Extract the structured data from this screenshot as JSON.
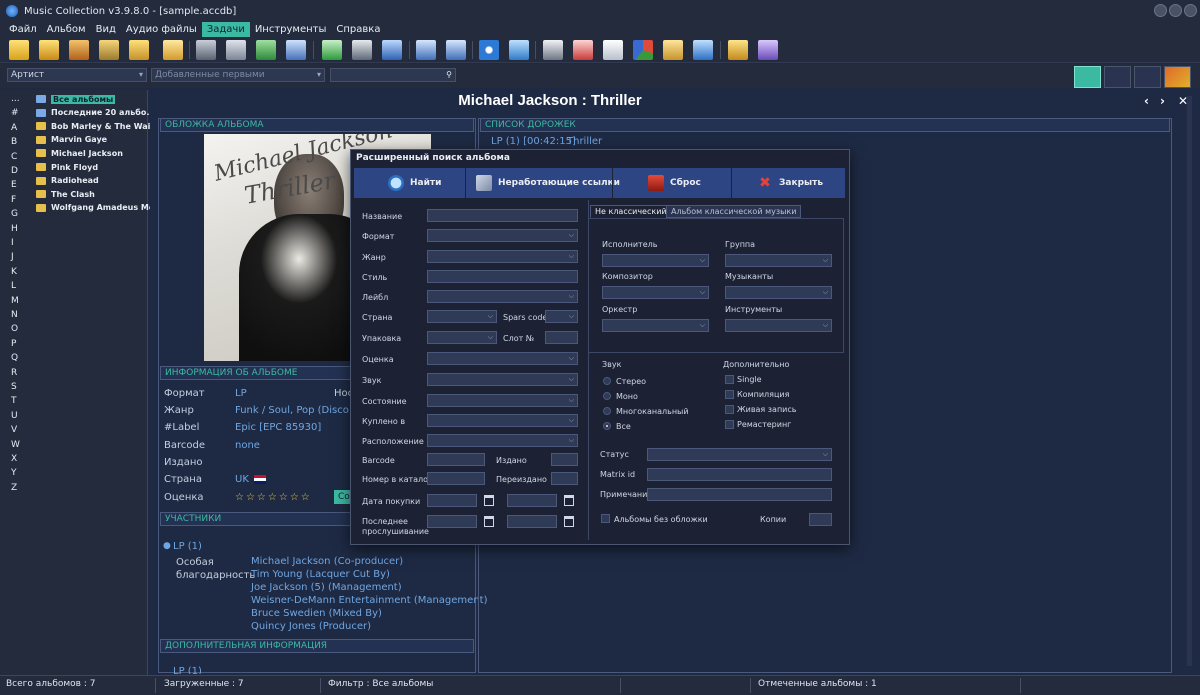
{
  "window": {
    "title": "Music Collection v3.9.8.0 - [sample.accdb]"
  },
  "menu": [
    "Файл",
    "Альбом",
    "Вид",
    "Аудио файлы",
    "Задачи",
    "Инструменты",
    "Справка"
  ],
  "filter": {
    "artist_combo": "Артист",
    "added_combo": "Добавленные первыми",
    "search_value": ""
  },
  "letters": [
    "...",
    "#",
    "A",
    "B",
    "C",
    "D",
    "E",
    "F",
    "G",
    "H",
    "I",
    "J",
    "K",
    "L",
    "M",
    "N",
    "O",
    "P",
    "Q",
    "R",
    "S",
    "T",
    "U",
    "V",
    "W",
    "X",
    "Y",
    "Z"
  ],
  "tree": [
    "Все альбомы",
    "Последние 20 альбо...",
    "Bob Marley & The Wai...",
    "Marvin Gaye",
    "Michael Jackson",
    "Pink Floyd",
    "Radiohead",
    "The Clash",
    "Wolfgang Amadeus Mo..."
  ],
  "album": {
    "title": "Michael Jackson : Thriller"
  },
  "sections": {
    "cover": "ОБЛОЖКА АЛЬБОМА",
    "tracks": "СПИСОК ДОРОЖЕК",
    "info": "ИНФОРМАЦИЯ ОБ АЛЬБОМЕ",
    "participants": "УЧАСТНИКИ",
    "extra": "ДОПОЛНИТЕЛЬНАЯ ИНФОРМАЦИЯ"
  },
  "tracklist": {
    "disc": "LP (1) [00:42:15]",
    "album": "Thriller"
  },
  "cover_art": {
    "line1": "Michael",
    "line2": "Jackson",
    "line3": "Thriller"
  },
  "info": [
    {
      "label": "Формат",
      "value": "LP"
    },
    {
      "label": "Жанр",
      "value": "Funk / Soul, Pop (Disco)"
    },
    {
      "label": "#Label",
      "value": "Epic [EPC 85930]"
    },
    {
      "label": "Barcode",
      "value": "none"
    },
    {
      "label": "Издано",
      "value": ""
    },
    {
      "label": "Страна",
      "value": "UK"
    },
    {
      "label": "Оценка",
      "value": "☆☆☆☆☆☆☆"
    }
  ],
  "info_extra": {
    "truncated_label": "Нос",
    "save_button": "Со"
  },
  "participants": {
    "disc": "LP (1)",
    "role": "Особая благодарность",
    "people": [
      "Michael Jackson (Co-producer)",
      "Tim Young (Lacquer Cut By)",
      "Joe Jackson (5) (Management)",
      "Weisner-DeMann Entertainment (Management)",
      "Bruce Swedien (Mixed By)",
      "Quincy Jones (Producer)"
    ],
    "extra_truncated": "LP (1)"
  },
  "dialog": {
    "title": "Расширенный поиск альбома",
    "buttons": {
      "find": "Найти",
      "broken": "Неработающие ссылки",
      "reset": "Сброс",
      "close": "Закрыть"
    },
    "fields": {
      "name": "Название",
      "format": "Формат",
      "genre": "Жанр",
      "style": "Стиль",
      "label": "Лейбл",
      "country": "Страна",
      "spars": "Spars code",
      "package": "Упаковка",
      "slot": "Слот №",
      "rating": "Оценка",
      "sound": "Звук",
      "condition": "Состояние",
      "bought": "Куплено в",
      "location": "Расположение",
      "barcode": "Barcode",
      "issued": "Издано",
      "catalog": "Номер в каталог",
      "reissued": "Переиздано",
      "purchase_date": "Дата покупки",
      "last_listen": "Последнее прослушивание"
    },
    "tabs": [
      "Не классический",
      "Альбом классической музыки"
    ],
    "right": {
      "performer": "Исполнитель",
      "group": "Группа",
      "composer": "Композитор",
      "musicians": "Музыканты",
      "orchestra": "Оркестр",
      "instruments": "Инструменты",
      "sound_title": "Звук",
      "sound_opts": [
        "Стерео",
        "Моно",
        "Многоканальный",
        "Все"
      ],
      "extra_title": "Дополнительно",
      "extra_opts": [
        "Single",
        "Компиляция",
        "Живая запись",
        "Ремастеринг"
      ],
      "status": "Статус",
      "matrix": "Matrix id",
      "notes": "Примечания",
      "no_cover": "Альбомы без обложки",
      "copies": "Копии"
    }
  },
  "status": {
    "total": "Всего альбомов : 7",
    "loaded": "Загруженные : 7",
    "filter": "Фильтр : Все альбомы",
    "marked": "Отмеченные альбомы : 1"
  }
}
